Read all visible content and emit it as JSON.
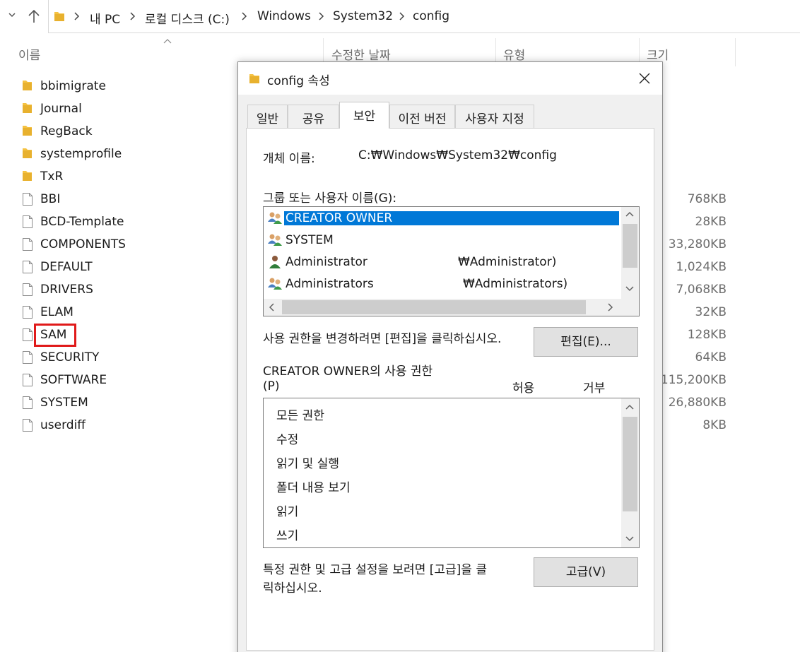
{
  "window": {
    "breadcrumb": [
      "내 PC",
      "로컬 디스크 (C:)",
      "Windows",
      "System32",
      "config"
    ]
  },
  "columns": {
    "name": "이름",
    "modified": "수정한 날짜",
    "type": "유형",
    "size": "크기"
  },
  "files": [
    {
      "name": "bbimigrate",
      "kind": "folder",
      "size": ""
    },
    {
      "name": "Journal",
      "kind": "folder",
      "size": ""
    },
    {
      "name": "RegBack",
      "kind": "folder",
      "size": ""
    },
    {
      "name": "systemprofile",
      "kind": "folder",
      "size": ""
    },
    {
      "name": "TxR",
      "kind": "folder",
      "size": ""
    },
    {
      "name": "BBI",
      "kind": "file",
      "size": "768KB"
    },
    {
      "name": "BCD-Template",
      "kind": "file",
      "size": "28KB"
    },
    {
      "name": "COMPONENTS",
      "kind": "file",
      "size": "33,280KB"
    },
    {
      "name": "DEFAULT",
      "kind": "file",
      "size": "1,024KB"
    },
    {
      "name": "DRIVERS",
      "kind": "file",
      "size": "7,068KB"
    },
    {
      "name": "ELAM",
      "kind": "file",
      "size": "32KB"
    },
    {
      "name": "SAM",
      "kind": "file",
      "size": "128KB",
      "highlighted": true
    },
    {
      "name": "SECURITY",
      "kind": "file",
      "size": "64KB"
    },
    {
      "name": "SOFTWARE",
      "kind": "file",
      "size": "115,200KB"
    },
    {
      "name": "SYSTEM",
      "kind": "file",
      "size": "26,880KB"
    },
    {
      "name": "userdiff",
      "kind": "file",
      "size": "8KB"
    }
  ],
  "dialog": {
    "title": "config 속성",
    "tabs": [
      "일반",
      "공유",
      "보안",
      "이전 버전",
      "사용자 지정"
    ],
    "active_tab": "보안",
    "object_name_label": "개체 이름:",
    "object_name_value": "C:₩Windows₩System32₩config",
    "groups_label": "그룹 또는 사용자 이름(G):",
    "groups": [
      {
        "name": "CREATOR OWNER",
        "extra": "",
        "icon": "group-users-icon",
        "selected": true
      },
      {
        "name": "SYSTEM",
        "extra": "",
        "icon": "group-users-icon",
        "selected": false
      },
      {
        "name": "Administrator",
        "extra": "₩Administrator)",
        "icon": "single-user-icon",
        "selected": false
      },
      {
        "name": "Administrators",
        "extra": "₩Administrators)",
        "icon": "group-users-icon",
        "selected": false
      }
    ],
    "edit_hint": "사용 권한을 변경하려면 [편집]을 클릭하십시오.",
    "edit_button": "편집(E)...",
    "perm_title": "CREATOR OWNER의 사용 권한",
    "perm_p": "(P)",
    "allow_header": "허용",
    "deny_header": "거부",
    "permissions": [
      "모든 권한",
      "수정",
      "읽기 및 실행",
      "폴더 내용 보기",
      "읽기",
      "쓰기"
    ],
    "advanced_hint_line1": "특정 권한 및 고급 설정을 보려면 [고급]을 클",
    "advanced_hint_line2": "릭하십시오.",
    "advanced_button": "고급(V)"
  },
  "colors": {
    "selection": "#0078d7",
    "highlight_box": "#e01a1a",
    "folder": "#f5c242"
  }
}
